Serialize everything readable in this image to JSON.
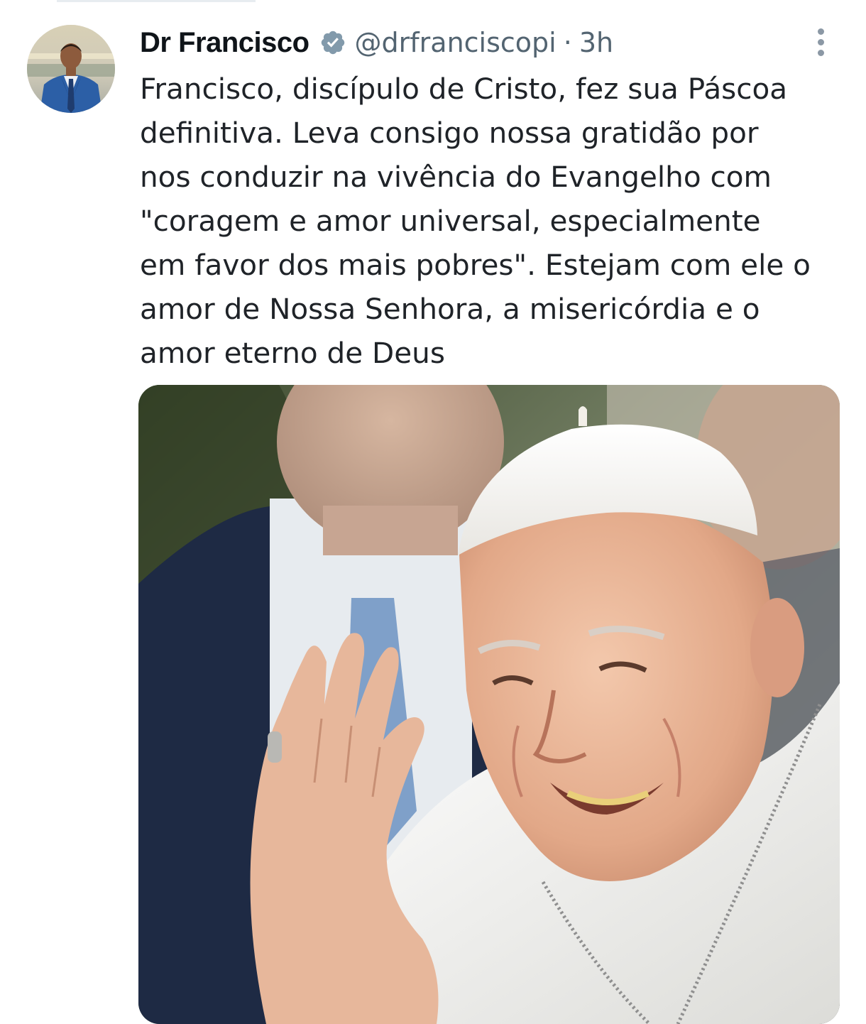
{
  "tweet": {
    "author": {
      "display_name": "Dr Francisco",
      "handle": "@drfranciscopi",
      "verified_icon": "verified-badge-icon",
      "avatar_icon": "profile-avatar"
    },
    "separator": "·",
    "time": "3h",
    "more_icon": "more-options-icon",
    "text": "Francisco, discípulo de Cristo, fez sua Páscoa\ndefinitiva. Leva consigo nossa gratidão por\nnos conduzir na vivência do Evangelho com\n\"coragem e amor universal, especialmente\nem favor dos mais pobres\". Estejam com ele o\namor de Nossa Senhora, a misericórdia e o\namor eterno de Deus",
    "media": {
      "kind": "photo",
      "description_icon": "pope-photo"
    }
  },
  "colors": {
    "text_primary": "#0f1419",
    "text_secondary": "#536471",
    "verified": "#829aab"
  }
}
